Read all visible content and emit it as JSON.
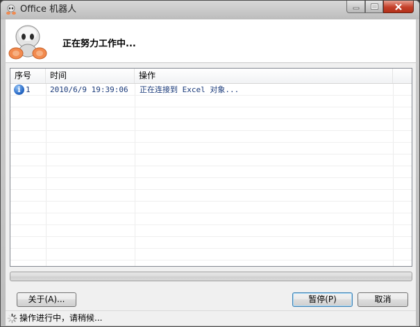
{
  "window": {
    "title": "Office 机器人"
  },
  "header": {
    "status_heading": "正在努力工作中..."
  },
  "list": {
    "columns": [
      "序号",
      "时间",
      "操作"
    ],
    "rows": [
      {
        "index": "1",
        "time": "2010/6/9 19:39:06",
        "action": "正在连接到 Excel 对象...",
        "icon": "info-icon"
      }
    ]
  },
  "progress": {
    "value": 0
  },
  "buttons": {
    "about": "关于(A)...",
    "pause": "暂停(P)",
    "cancel": "取消"
  },
  "statusbar": {
    "text": "操作进行中，请稍候..."
  },
  "colors": {
    "accent": "#3c7fb1",
    "text_blue": "#1a3a7a",
    "close_red": "#c4402a"
  }
}
